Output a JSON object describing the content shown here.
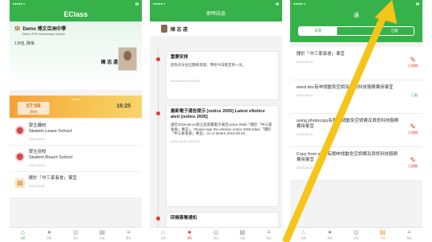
{
  "phone1": {
    "header_title": "EClass",
    "school_name": "Demo 博文亞洲中學",
    "school_en": "Demo PSS Secondary School",
    "class_line": "1.B班, 陳偉",
    "student_name": "陳 志 遠",
    "time_label": "today",
    "time_in": "07:58",
    "time_in_note": "(準時)",
    "time_out": "16:25",
    "items": [
      {
        "icon": "leave-icon",
        "title_zh": "學生離校",
        "title_en": "Student Leave School",
        "date": "2015-08-01"
      },
      {
        "icon": "arrive-icon",
        "title_zh": "學生到校",
        "title_en": "Student Reach School",
        "date": "2015-08-01"
      },
      {
        "icon": "notice-icon",
        "title_zh": "關於「中三家長會」事宜",
        "title_en": "",
        "date": "2015-08-03"
      }
    ],
    "tabs": [
      "主頁",
      "通知",
      "訊息",
      "日誌",
      "更多"
    ]
  },
  "phone2": {
    "header_title": "即時訊息",
    "user_name": "陳 志 遠",
    "cards": [
      {
        "title": "重要安排",
        "body": "因為天文台已懸掛黑雨，學校今日暫定停一天。",
        "date": "2014-06-01 10:30:07"
      },
      {
        "title": "最新電子通告提示 [notice 2005] Latest eNotice alert [notice 2005]",
        "body": "請於2015-06-24或之前簽署電子通告notice 2005「關於「中三家長會」事宜」。Please sign the eNotice notice 2005 titled 「關於「中三家長會」事宜」on or before 2015-06-24.",
        "date": "2015-06-20 10:20:11"
      },
      {
        "title": "回條簽署通知",
        "body": "",
        "date": ""
      }
    ],
    "tabs": [
      "主頁",
      "通知",
      "訊息",
      "日誌",
      "更多"
    ]
  },
  "phone3": {
    "header_title": "通",
    "segments": [
      "未簽",
      "",
      "已簽"
    ],
    "items": [
      {
        "title": "關於「中三家長會」事宜",
        "date": "2015-08-03",
        "status": "已過期",
        "status_type": "expired"
      },
      {
        "title": "word doc有申請動免空調及資訊科技服務費用事宜",
        "date": "2015-08-01",
        "status": "已簽",
        "status_type": "signed"
      },
      {
        "title": "using photocopy有關申請動免空調費及資訊科技服務費用事宜",
        "date": "2015-08-13",
        "status": "已過期",
        "status_type": "expired"
      },
      {
        "title": "Copy from word有關申請動免空調費及資訊科技服務費用事宜",
        "date": "2015-08-13",
        "status": "已過期",
        "status_type": "expired"
      }
    ],
    "tabs": [
      "主頁",
      "通知",
      "訊息",
      "日誌",
      "更多"
    ]
  }
}
